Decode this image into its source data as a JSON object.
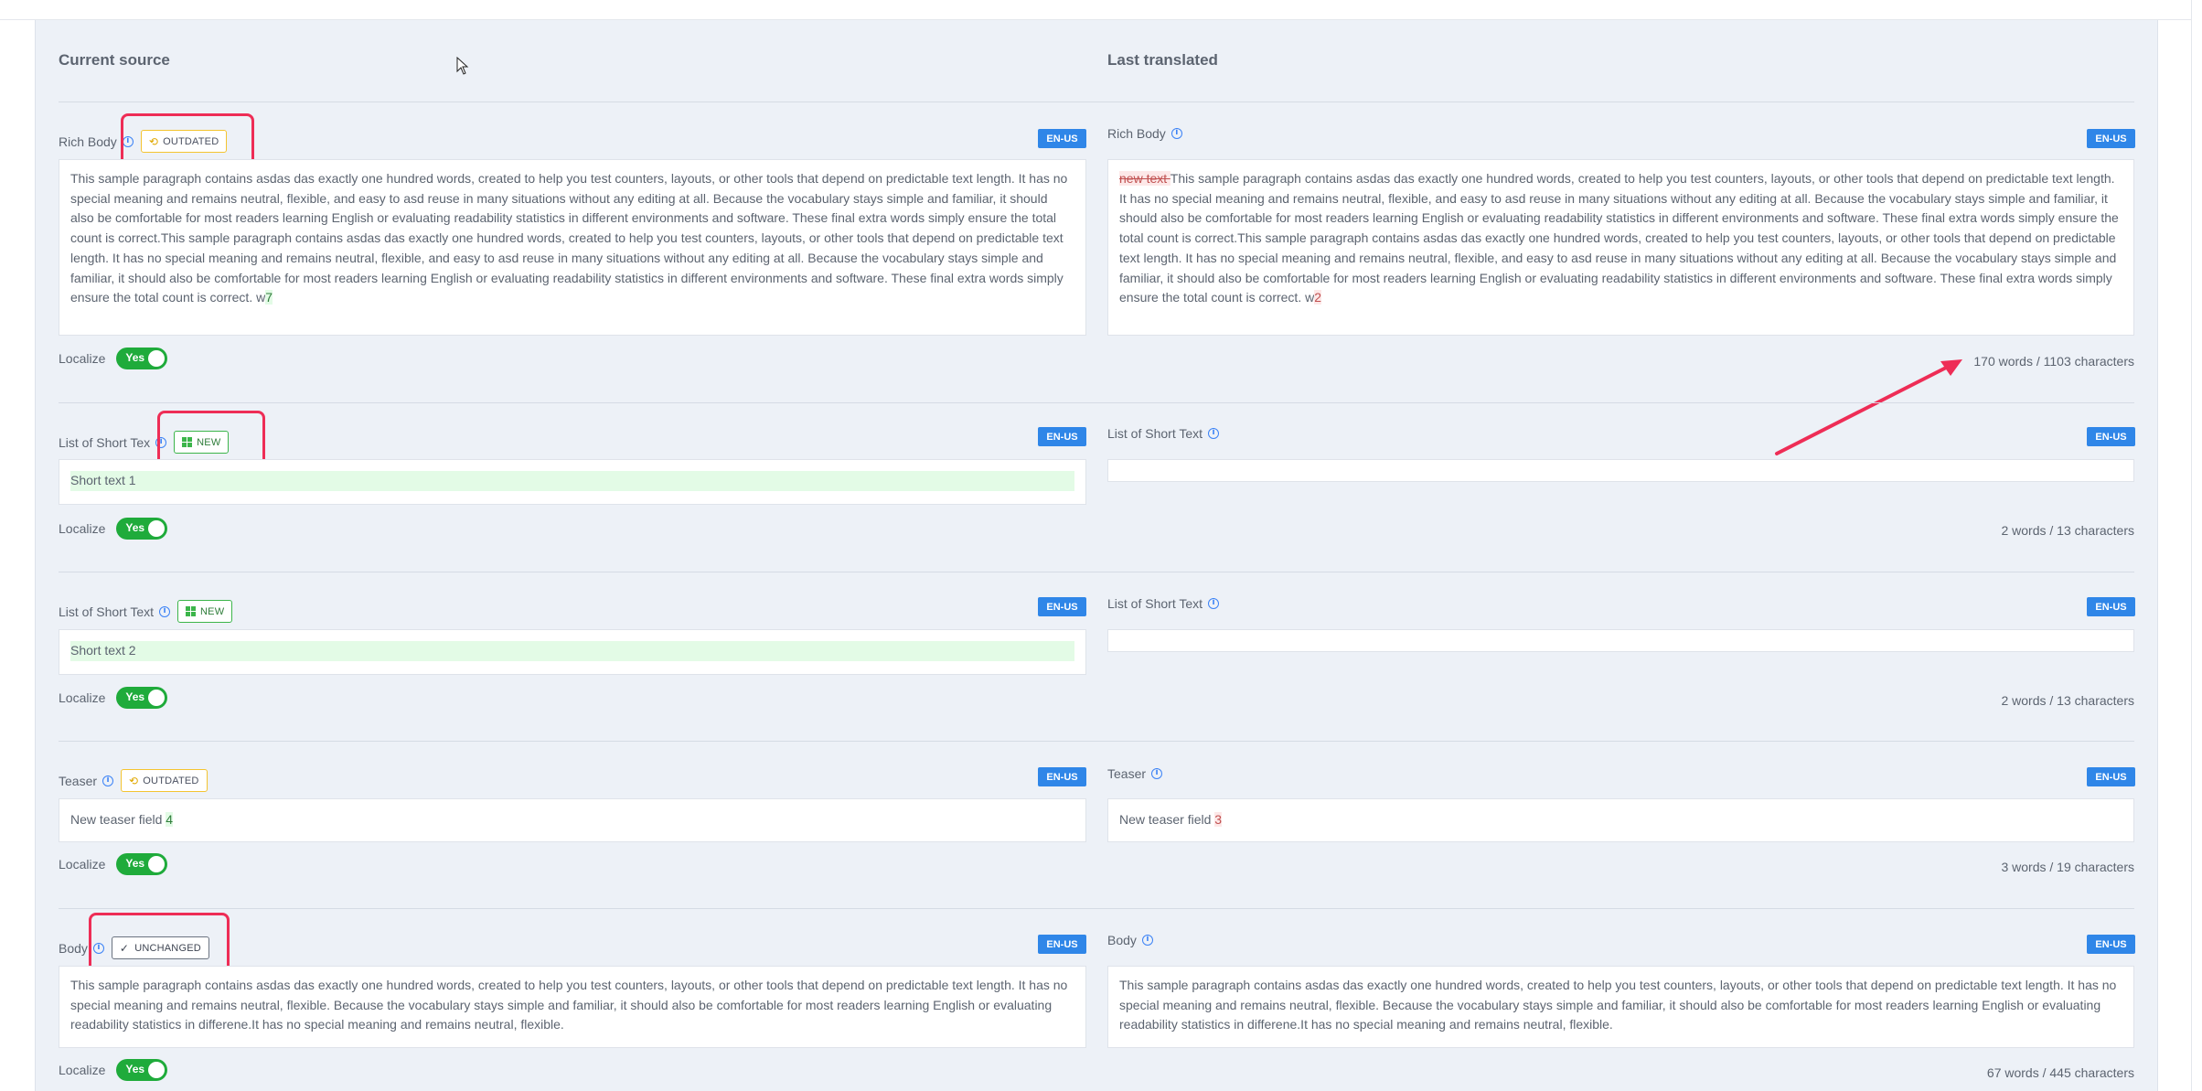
{
  "headers": {
    "current": "Current source",
    "last": "Last translated"
  },
  "lang": "EN-US",
  "localize_label": "Localize",
  "toggle_yes": "Yes",
  "badges": {
    "outdated": "OUTDATED",
    "new": "NEW",
    "unchanged": "UNCHANGED"
  },
  "rows": [
    {
      "label": "Rich Body",
      "source_text": "This sample paragraph contains asdas das exactly one hundred words, created to help you test counters, layouts, or other tools that depend on predictable text length. It has no special meaning and remains neutral, flexible, and easy to asd reuse in many situations without any editing at all. Because the vocabulary stays simple and familiar, it should also be comfortable for most readers learning English or evaluating readability statistics in different environments and software. These final extra words simply ensure the total count is correct.This sample paragraph contains asdas das exactly one hundred words, created to help you test counters, layouts, or other tools that depend on predictable text length. It has no special meaning and remains neutral, flexible, and easy to asd reuse in many situations without any editing at all. Because the vocabulary stays simple and familiar, it should also be comfortable for most readers learning English or evaluating readability statistics in different environments and software. These final extra words simply ensure the total count is correct. w",
      "source_added": "7",
      "target_removed": "new text ",
      "target_text": "This sample paragraph contains asdas das exactly one hundred words, created to help you test counters, layouts, or other tools that depend on predictable text length. It has no special meaning and remains neutral, flexible, and easy to asd reuse in many situations without any editing at all. Because the vocabulary stays simple and familiar, it should also be comfortable for most readers learning English or evaluating readability statistics in different environments and software. These final extra words simply ensure the total count is correct.This sample paragraph contains asdas das exactly one hundred words, created to help you test counters, layouts, or other tools that depend on predictable text length. It has no special meaning and remains neutral, flexible, and easy to asd reuse in many situations without any editing at all. Because the vocabulary stays simple and familiar, it should also be comfortable for most readers learning English or evaluating readability statistics in different environments and software. These final extra words simply ensure the total count is correct. w",
      "target_old": "2",
      "count": "170 words / 1103 characters"
    },
    {
      "label": "List of Short Text",
      "label_cut": "List of Short Tex",
      "source_text": "Short text 1",
      "count": "2 words / 13 characters"
    },
    {
      "label": "List of Short Text",
      "source_text": "Short text 2",
      "count": "2 words / 13 characters"
    },
    {
      "label": "Teaser",
      "source_text": "New teaser field ",
      "source_added": "4",
      "target_text": "New teaser field ",
      "target_old": "3",
      "count": "3 words / 19 characters"
    },
    {
      "label": "Body",
      "source_text": "This sample paragraph contains asdas das exactly one hundred words, created to help you test counters, layouts, or other tools that depend on predictable text length. It has no special meaning and remains neutral, flexible. Because the vocabulary stays simple and familiar, it should also be comfortable for most readers learning English or evaluating readability statistics in differene.It has no special meaning and remains neutral, flexible.",
      "target_text": "This sample paragraph contains asdas das exactly one hundred words, created to help you test counters, layouts, or other tools that depend on predictable text length. It has no special meaning and remains neutral, flexible. Because the vocabulary stays simple and familiar, it should also be comfortable for most readers learning English or evaluating readability statistics in differene.It has no special meaning and remains neutral, flexible.",
      "count": "67 words / 445 characters"
    }
  ],
  "colors": {
    "accent_blue": "#2f86e8",
    "toggle_green": "#1fab3b",
    "annotation_red": "#ee2d56",
    "outdated_yellow": "#f4c430",
    "new_green": "#3cb54a"
  }
}
